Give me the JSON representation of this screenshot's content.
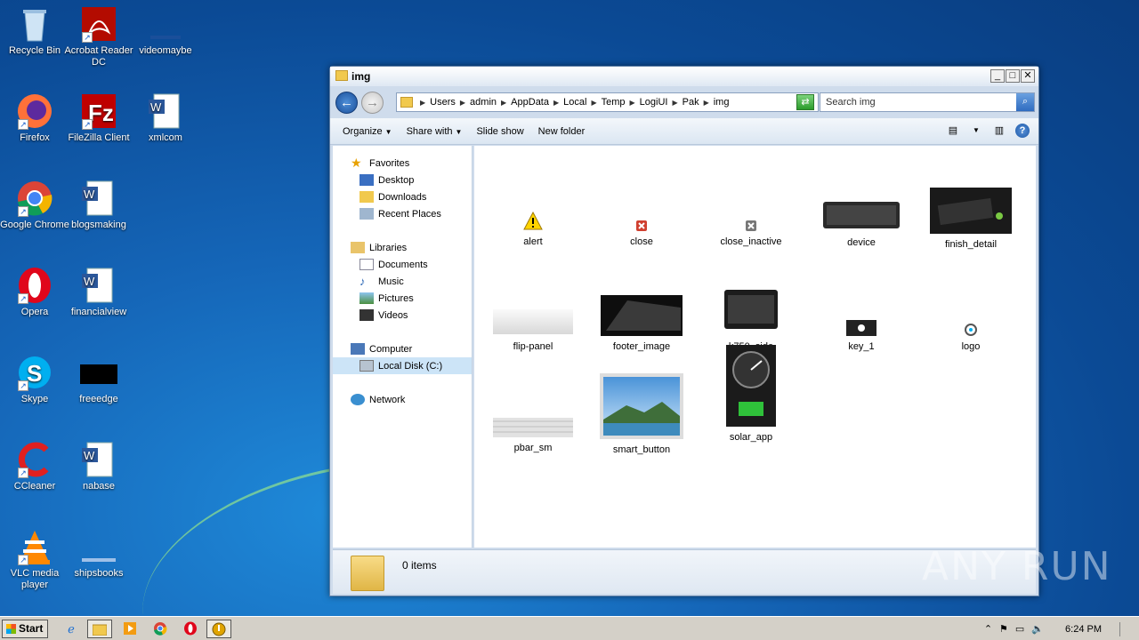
{
  "desktop": {
    "icons": [
      {
        "label": "Recycle Bin",
        "icon": "recycle-bin-icon"
      },
      {
        "label": "Acrobat Reader DC",
        "icon": "acrobat-icon"
      },
      {
        "label": "videomaybe",
        "icon": "blank-file-icon"
      },
      {
        "label": "Firefox",
        "icon": "firefox-icon"
      },
      {
        "label": "FileZilla Client",
        "icon": "filezilla-icon"
      },
      {
        "label": "xmlcom",
        "icon": "word-doc-icon"
      },
      {
        "label": "Google Chrome",
        "icon": "chrome-icon"
      },
      {
        "label": "blogsmaking",
        "icon": "word-doc-icon"
      },
      {
        "label": "Opera",
        "icon": "opera-icon"
      },
      {
        "label": "financialview",
        "icon": "word-doc-icon"
      },
      {
        "label": "Skype",
        "icon": "skype-icon"
      },
      {
        "label": "freeedge",
        "icon": "black-file-icon"
      },
      {
        "label": "CCleaner",
        "icon": "ccleaner-icon"
      },
      {
        "label": "nabase",
        "icon": "word-doc-icon"
      },
      {
        "label": "VLC media player",
        "icon": "vlc-icon"
      },
      {
        "label": "shipsbooks",
        "icon": "blank-file-icon"
      }
    ]
  },
  "window": {
    "title": "img",
    "controls": {
      "minimize": "_",
      "maximize": "□",
      "close": "✕"
    },
    "address": {
      "crumbs": [
        "Users",
        "admin",
        "AppData",
        "Local",
        "Temp",
        "LogiUI",
        "Pak",
        "img"
      ]
    },
    "search_placeholder": "Search img",
    "commands": {
      "organize": "Organize",
      "share_with": "Share with",
      "slide_show": "Slide show",
      "new_folder": "New folder"
    },
    "nav": {
      "favorites": "Favorites",
      "desktop": "Desktop",
      "downloads": "Downloads",
      "recent_places": "Recent Places",
      "libraries": "Libraries",
      "documents": "Documents",
      "music": "Music",
      "pictures": "Pictures",
      "videos": "Videos",
      "computer": "Computer",
      "local_disk": "Local Disk (C:)",
      "network": "Network"
    },
    "files": [
      {
        "name": "alert"
      },
      {
        "name": "close"
      },
      {
        "name": "close_inactive"
      },
      {
        "name": "device"
      },
      {
        "name": "finish_detail"
      },
      {
        "name": "flip-panel"
      },
      {
        "name": "footer_image"
      },
      {
        "name": "k750_side"
      },
      {
        "name": "key_1"
      },
      {
        "name": "logo"
      },
      {
        "name": "pbar_sm"
      },
      {
        "name": "smart_button"
      },
      {
        "name": "solar_app"
      }
    ],
    "status": {
      "count": "0 items"
    }
  },
  "watermark": "ANY RUN",
  "taskbar": {
    "start_label": "Start",
    "clock": "6:24 PM"
  },
  "colors": {
    "accent": "#1566b8",
    "taskbar": "#d4d0c8"
  }
}
